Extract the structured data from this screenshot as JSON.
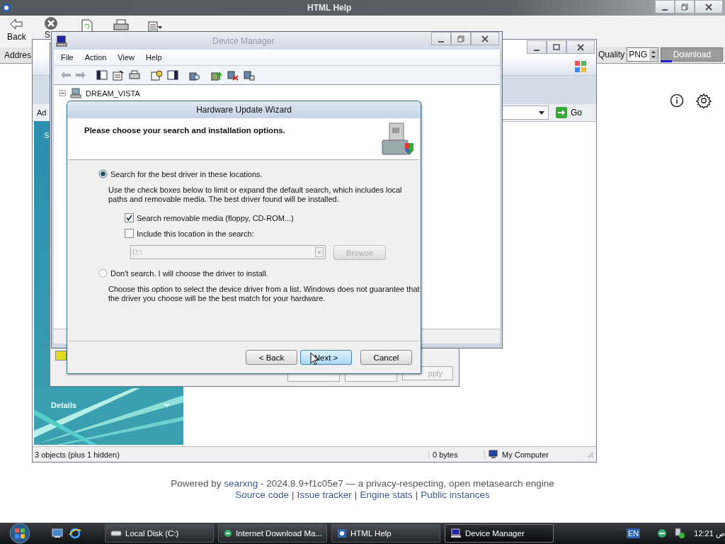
{
  "html_help": {
    "title": "HTML Help",
    "toolbar": [
      {
        "label": "Back"
      },
      {
        "label": "S"
      }
    ],
    "address_label": "Addres",
    "quality_label": "Quality",
    "format": "PNG",
    "download": {
      "label": "Download",
      "disabled": true
    }
  },
  "explorer": {
    "address_label": "Ad",
    "side_label": "S",
    "go": "Go",
    "details": "Details",
    "status": [
      "3 objects (plus 1 hidden)",
      "0 bytes",
      "My Computer"
    ]
  },
  "properties": {
    "apply": {
      "label": "pply",
      "disabled": true
    }
  },
  "device_manager": {
    "title": "Device Manager",
    "menu": [
      "File",
      "Action",
      "View",
      "Help"
    ],
    "tree_root": {
      "label": "DREAM_VISTA",
      "expanded": true
    }
  },
  "wizard": {
    "title": "Hardware Update Wizard",
    "heading": "Please choose your search and installation options.",
    "options": [
      {
        "label": "Search for the best driver in these locations.",
        "selected": true,
        "description": "Use the check boxes below to limit or expand the default search, which includes local paths and removable media. The best driver found will be installed."
      },
      {
        "label": "Don't search. I will choose the driver to install.",
        "selected": false,
        "description": "Choose this option to select the device driver from a list.  Windows does not guarantee that the driver you choose will be the best match for your hardware."
      }
    ],
    "checks": [
      {
        "label": "Search removable media (floppy, CD-ROM...)",
        "checked": true
      },
      {
        "label": "Include this location in the search:",
        "checked": false
      }
    ],
    "location": {
      "value": "D:\\",
      "disabled": true
    },
    "browse": {
      "label": "Browse",
      "disabled": true
    },
    "buttons": [
      {
        "label": "< Back",
        "focused": false
      },
      {
        "label": "Next >",
        "focused": true
      },
      {
        "label": "Cancel",
        "focused": false
      }
    ]
  },
  "footer": {
    "prefix": "Powered by",
    "link": "searxng",
    "suffix": "- 2024.8.9+f1c05e7 — a privacy-respecting, open metasearch engine",
    "links": [
      "Source code",
      "Issue tracker",
      "Engine stats",
      "Public instances"
    ],
    "separator": "|"
  },
  "taskbar": {
    "tasks": [
      {
        "label": "Local Disk (C:)",
        "selected": false
      },
      {
        "label": "Internet Download Ma...",
        "selected": false
      },
      {
        "label": "HTML Help",
        "selected": false
      },
      {
        "label": "Device Manager",
        "selected": true
      }
    ],
    "language": "EN",
    "clock": "12:21 ص"
  }
}
